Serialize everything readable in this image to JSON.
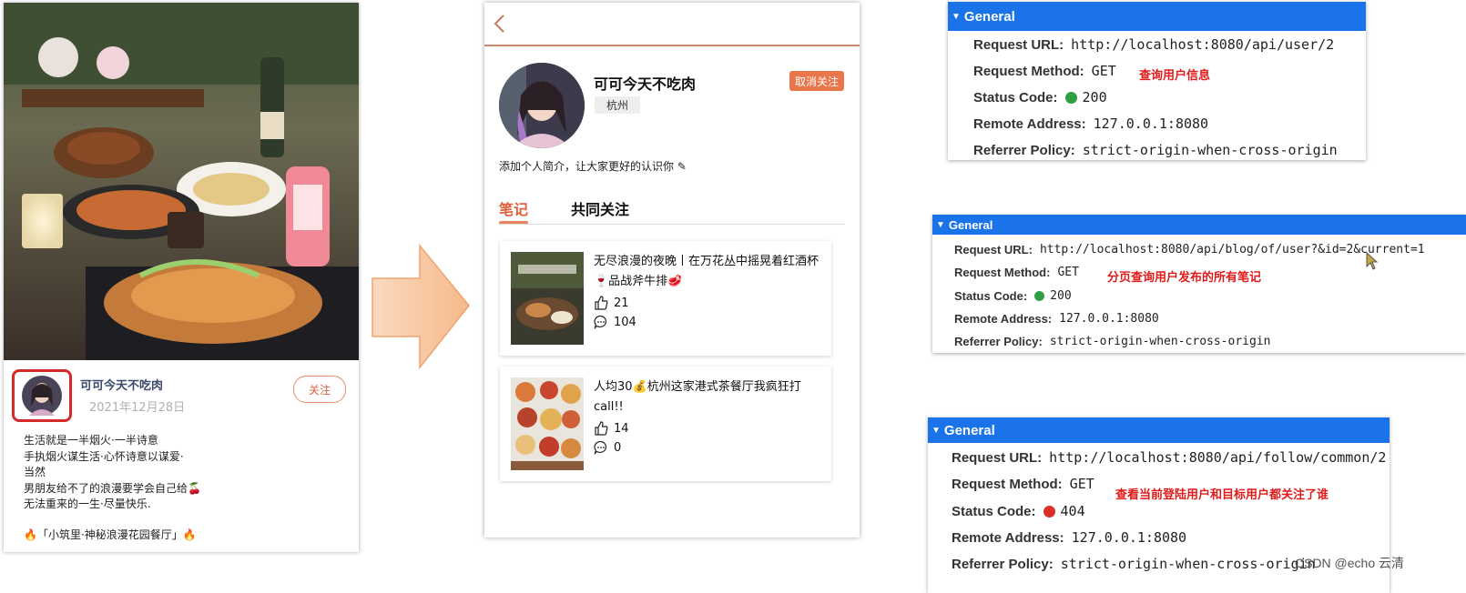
{
  "blog_card": {
    "author": "可可今天不吃肉",
    "date": "2021年12月28日",
    "follow_label": "关注",
    "text_lines": [
      "生活就是一半烟火·一半诗意",
      "手执烟火谋生活·心怀诗意以谋爱·",
      "当然",
      "男朋友给不了的浪漫要学会自己给🍒",
      "无法重来的一生·尽量快乐."
    ],
    "tag_line": "🔥「小筑里·神秘浪漫花园餐厅」🔥"
  },
  "profile": {
    "name": "可可今天不吃肉",
    "city": "杭州",
    "unfollow_label": "取消关注",
    "intro": "添加个人简介，让大家更好的认识你 ✎",
    "tabs": [
      "笔记",
      "共同关注"
    ],
    "notes": [
      {
        "title": "无尽浪漫的夜晚丨在万花丛中摇晃着红酒杯🍷品战斧牛排🥩",
        "likes": "21",
        "comments": "104"
      },
      {
        "title": "人均30💰杭州这家港式茶餐厅我疯狂打call!!",
        "likes": "14",
        "comments": "0"
      }
    ]
  },
  "panels": [
    {
      "title": "General",
      "request_url_label": "Request URL:",
      "request_url": "http://localhost:8080/api/user/2",
      "method_label": "Request Method:",
      "method": "GET",
      "status_label": "Status Code:",
      "status": "200",
      "status_color": "#2ea043",
      "remote_label": "Remote Address:",
      "remote": "127.0.0.1:8080",
      "referrer_label": "Referrer Policy:",
      "referrer": "strict-origin-when-cross-origin",
      "note": "查询用户信息"
    },
    {
      "title": "General",
      "request_url_label": "Request URL:",
      "request_url": "http://localhost:8080/api/blog/of/user?&id=2&current=1",
      "method_label": "Request Method:",
      "method": "GET",
      "status_label": "Status Code:",
      "status": "200",
      "status_color": "#2ea043",
      "remote_label": "Remote Address:",
      "remote": "127.0.0.1:8080",
      "referrer_label": "Referrer Policy:",
      "referrer": "strict-origin-when-cross-origin",
      "note": "分页查询用户发布的所有笔记"
    },
    {
      "title": "General",
      "request_url_label": "Request URL:",
      "request_url": "http://localhost:8080/api/follow/common/2",
      "method_label": "Request Method:",
      "method": "GET",
      "status_label": "Status Code:",
      "status": "404",
      "status_color": "#d93025",
      "remote_label": "Remote Address:",
      "remote": "127.0.0.1:8080",
      "referrer_label": "Referrer Policy:",
      "referrer": "strict-origin-when-cross-origin",
      "note": "查看当前登陆用户和目标用户都关注了谁"
    }
  ],
  "watermark": "CSDN @echo 云清",
  "colors": {
    "accent": "#e9764a",
    "devtools_blue": "#1a73e8",
    "note_red": "#e11a1a"
  }
}
